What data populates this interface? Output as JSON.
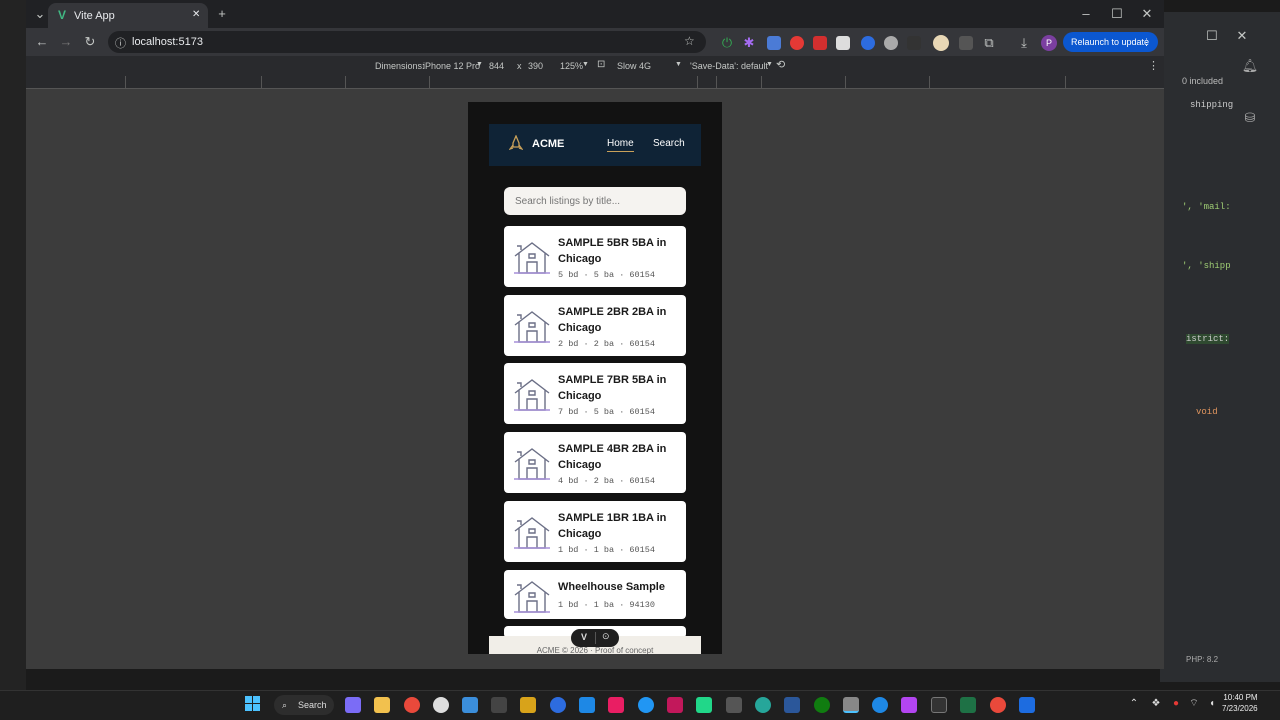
{
  "browser": {
    "tab_title": "Vite App",
    "address": "localhost:5173",
    "relaunch_label": "Relaunch to update",
    "profile_initial": "P"
  },
  "devtools": {
    "dimensions_label": "Dimensions:",
    "device": "iPhone 12 Pro",
    "width": "844",
    "times": "x",
    "height": "390",
    "zoom": "125%",
    "throttle": "Slow 4G",
    "save_data": "'Save-Data': default"
  },
  "ide": {
    "included": "0 included",
    "shipping": "shipping",
    "mail": "', 'mail:",
    "shipp": "', 'shipp",
    "district": "istrict:",
    "void": "void",
    "php": "PHP: 8.2"
  },
  "app": {
    "brand": "ACME",
    "nav": {
      "home": "Home",
      "search": "Search"
    },
    "search_placeholder": "Search listings by title...",
    "listings": [
      {
        "title": "SAMPLE 5BR 5BA in Chicago",
        "meta": "5 bd · 5 ba · 60154"
      },
      {
        "title": "SAMPLE 2BR 2BA in Chicago",
        "meta": "2 bd · 2 ba · 60154"
      },
      {
        "title": "SAMPLE 7BR 5BA in Chicago",
        "meta": "7 bd · 5 ba · 60154"
      },
      {
        "title": "SAMPLE 4BR 2BA in Chicago",
        "meta": "4 bd · 2 ba · 60154"
      },
      {
        "title": "SAMPLE 1BR 1BA in Chicago",
        "meta": "1 bd · 1 ba · 60154"
      },
      {
        "title": "Wheelhouse Sample",
        "meta": "1 bd · 1 ba · 94130"
      }
    ],
    "footer": "ACME © 2026 · Proof of concept"
  },
  "taskbar": {
    "search_label": "Search",
    "time": "10:40 PM",
    "date": "7/23/2026"
  },
  "colors": {
    "navbar": "#0f2336",
    "accent": "#c9a15a",
    "relaunch": "#0b57d0"
  }
}
